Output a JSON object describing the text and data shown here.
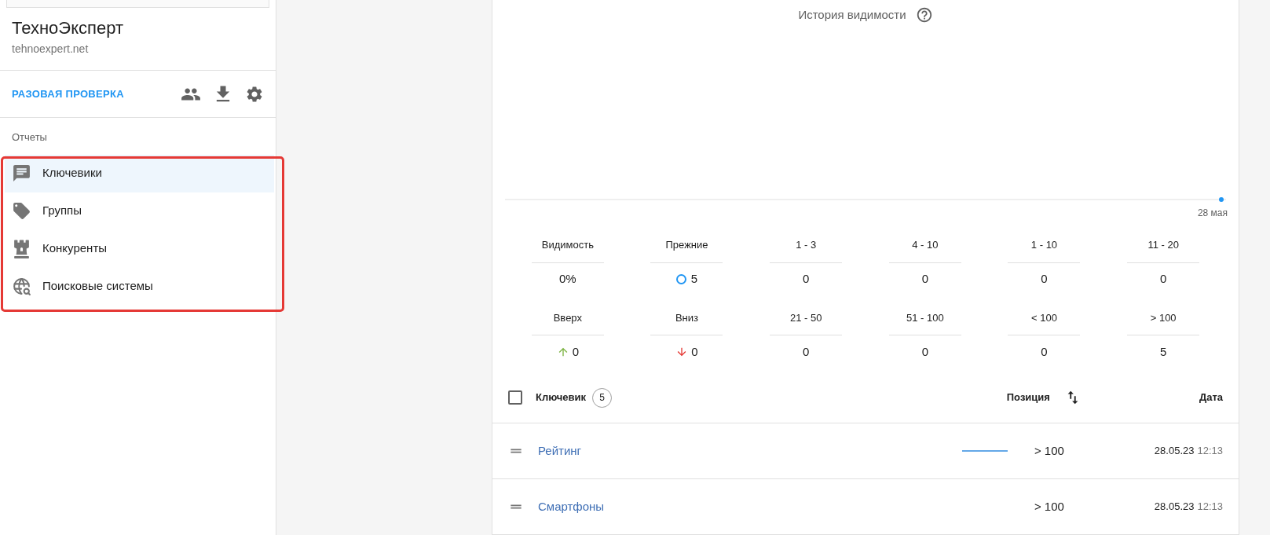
{
  "sidebar": {
    "title": "ТехноЭксперт",
    "domain": "tehnoexpert.net",
    "action": "РАЗОВАЯ ПРОВЕРКА",
    "section": "Отчеты",
    "highlighted": true,
    "items": [
      {
        "label": "Ключевики",
        "selected": true
      },
      {
        "label": "Группы",
        "selected": false
      },
      {
        "label": "Конкуренты",
        "selected": false
      },
      {
        "label": "Поисковые системы",
        "selected": false
      }
    ]
  },
  "chart": {
    "title": "История видимости",
    "date": "28 мая"
  },
  "stats": [
    {
      "label": "Видимость",
      "value": "0%",
      "kind": "plain"
    },
    {
      "label": "Прежние",
      "value": "5",
      "kind": "previous"
    },
    {
      "label": "1 - 3",
      "value": "0",
      "kind": "plain"
    },
    {
      "label": "4 - 10",
      "value": "0",
      "kind": "plain"
    },
    {
      "label": "1 - 10",
      "value": "0",
      "kind": "plain"
    },
    {
      "label": "11 - 20",
      "value": "0",
      "kind": "plain"
    },
    {
      "label": "Вверх",
      "value": "0",
      "kind": "up"
    },
    {
      "label": "Вниз",
      "value": "0",
      "kind": "down"
    },
    {
      "label": "21 - 50",
      "value": "0",
      "kind": "plain"
    },
    {
      "label": "51 - 100",
      "value": "0",
      "kind": "plain"
    },
    {
      "label": "< 100",
      "value": "0",
      "kind": "plain"
    },
    {
      "label": "> 100",
      "value": "5",
      "kind": "plain"
    }
  ],
  "table": {
    "select_all": {
      "checked": false
    },
    "columns": {
      "keyword": "Ключевик",
      "count": "5",
      "position": "Позиция",
      "date": "Дата"
    },
    "rows": [
      {
        "keyword": "Рейтинг",
        "position": "> 100",
        "date": "28.05.23",
        "time": "12:13",
        "trend": true
      },
      {
        "keyword": "Смартфоны",
        "position": "> 100",
        "date": "28.05.23",
        "time": "12:13",
        "trend": false
      }
    ]
  }
}
